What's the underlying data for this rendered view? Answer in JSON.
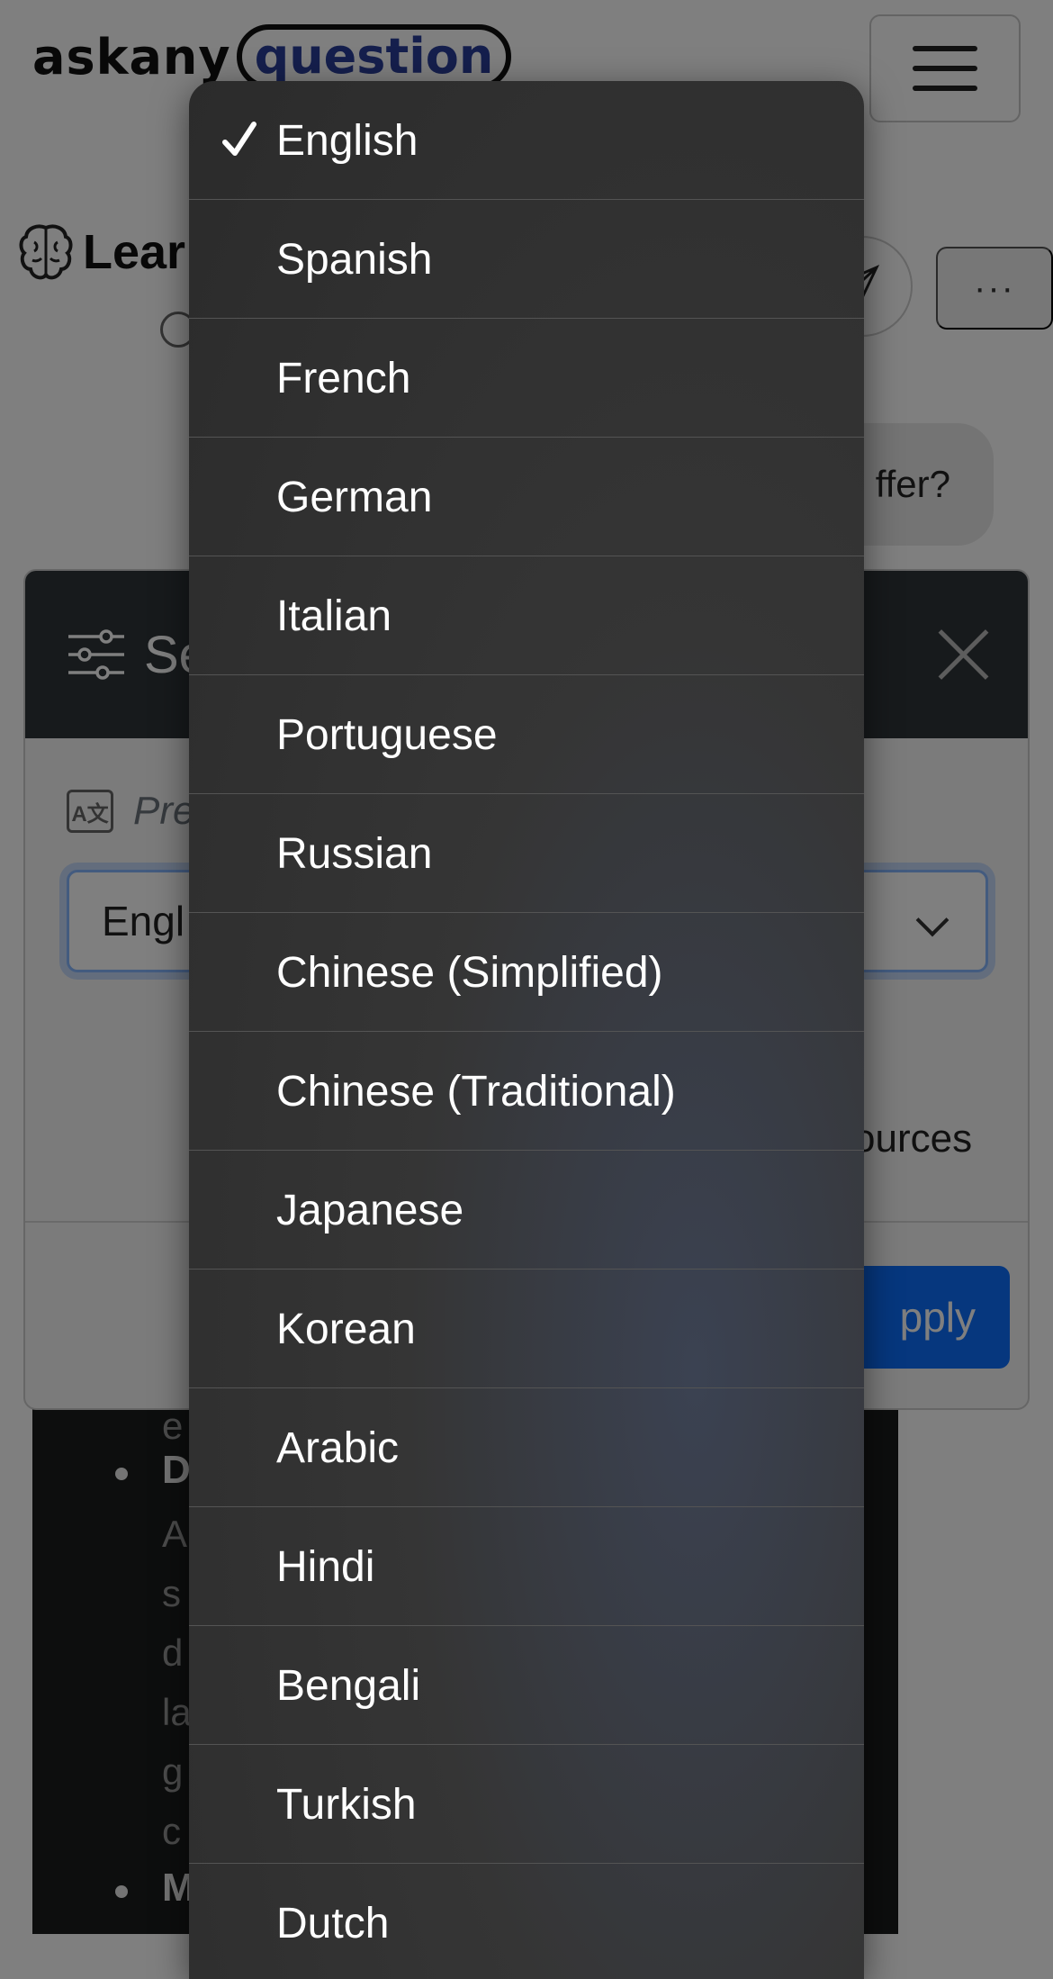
{
  "navbar": {
    "logo_part1": "askany",
    "logo_part2": "question"
  },
  "chat": {
    "title": "Lear",
    "user_message": "ffer?"
  },
  "answer": {
    "frag1": "e",
    "bold1": "D",
    "lines": [
      "A",
      "s",
      "d",
      "la",
      "g",
      "c"
    ],
    "bold2": "M"
  },
  "modal": {
    "title": "Se",
    "preferred_label": "Pre",
    "select_value": "Engl",
    "sources_text": "ources",
    "apply_label": "pply",
    "translate_icon_glyph": "A文"
  },
  "picker": {
    "selected_index": 0,
    "options": [
      "English",
      "Spanish",
      "French",
      "German",
      "Italian",
      "Portuguese",
      "Russian",
      "Chinese (Simplified)",
      "Chinese (Traditional)",
      "Japanese",
      "Korean",
      "Arabic",
      "Hindi",
      "Bengali",
      "Turkish",
      "Dutch"
    ]
  }
}
